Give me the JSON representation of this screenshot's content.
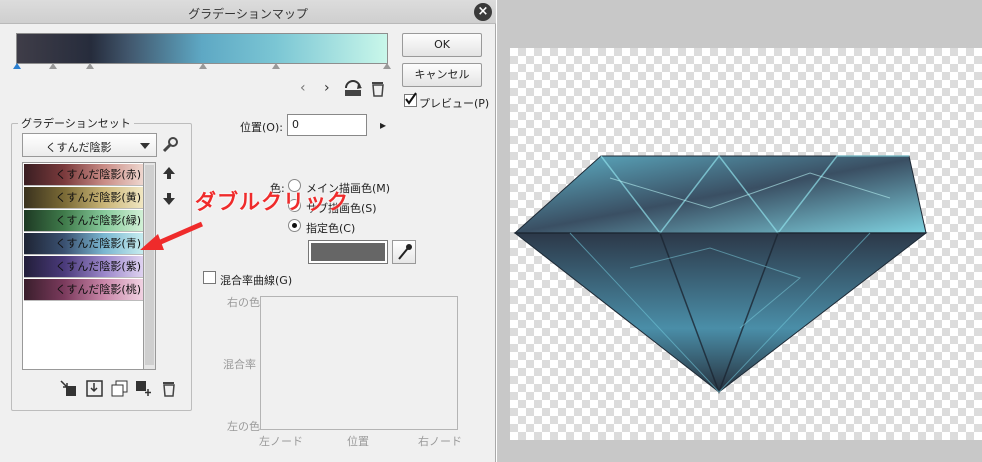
{
  "dialog": {
    "title": "グラデーションマップ",
    "ok_label": "OK",
    "cancel_label": "キャンセル",
    "preview_label": "プレビュー(P)",
    "preview_checked": true
  },
  "gradient_set": {
    "group_title": "グラデーションセット",
    "selected": "くすんだ陰影",
    "items": [
      {
        "label": "くすんだ陰影(赤)",
        "colors": [
          "#3a1e22",
          "#7a3a3c",
          "#c98c86",
          "#efd8d0"
        ]
      },
      {
        "label": "くすんだ陰影(黄)",
        "colors": [
          "#3a321e",
          "#7a6a36",
          "#c9b476",
          "#f2e8c4"
        ]
      },
      {
        "label": "くすんだ陰影(緑)",
        "colors": [
          "#1e3a24",
          "#3f7a4a",
          "#86c99a",
          "#d4f2d8"
        ]
      },
      {
        "label": "くすんだ陰影(青)",
        "colors": [
          "#1e2434",
          "#3a5070",
          "#7ab6d0",
          "#c8eef0"
        ]
      },
      {
        "label": "くすんだ陰影(紫)",
        "colors": [
          "#221e3a",
          "#4a3a7a",
          "#9a86c9",
          "#e0d4f2"
        ]
      },
      {
        "label": "くすんだ陰影(桃)",
        "colors": [
          "#3a1e2c",
          "#7a3a5c",
          "#c986a8",
          "#f2d4e4"
        ]
      }
    ]
  },
  "params": {
    "position_label": "位置(O):",
    "position_value": "0",
    "color_label": "色:",
    "radio_main": "メイン描画色(M)",
    "radio_sub": "サブ描画色(S)",
    "radio_specified": "指定色(C)",
    "specified_color": "#666666",
    "blend_curve_label": "混合率曲線(G)",
    "curve_right_color": "右の色",
    "curve_blend_rate": "混合率",
    "curve_left_color": "左の色",
    "curve_left_node": "左ノード",
    "curve_position": "位置",
    "curve_right_node": "右ノード"
  },
  "annotation": {
    "text": "ダブルクリック",
    "color": "#ef2b2b"
  },
  "icons": {
    "nav_prev": "‹",
    "nav_next": "›",
    "position_next": "▸"
  }
}
